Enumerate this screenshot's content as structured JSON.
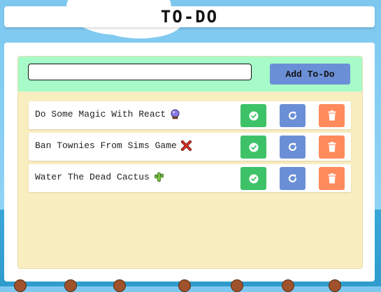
{
  "app": {
    "title": "TO-DO"
  },
  "input": {
    "value": "",
    "placeholder": ""
  },
  "add_button": {
    "label": "Add To-Do"
  },
  "todos": [
    {
      "text": "Do Some Magic With React",
      "emoji": "crystal-ball-icon"
    },
    {
      "text": "Ban Townies From Sims Game",
      "emoji": "red-x-icon"
    },
    {
      "text": "Water The Dead Cactus",
      "emoji": "cactus-icon"
    }
  ],
  "actions": {
    "complete": "check-circle-icon",
    "redo": "redo-arrow-icon",
    "delete": "trash-icon"
  },
  "colors": {
    "header_bar": "#a6fbc9",
    "list_background": "#f9eec0",
    "complete_button": "#3ec268",
    "redo_button": "#6b8fd6",
    "delete_button": "#ff8a5c",
    "sky": "#8fd3f6",
    "water": "#2f9ccd"
  }
}
